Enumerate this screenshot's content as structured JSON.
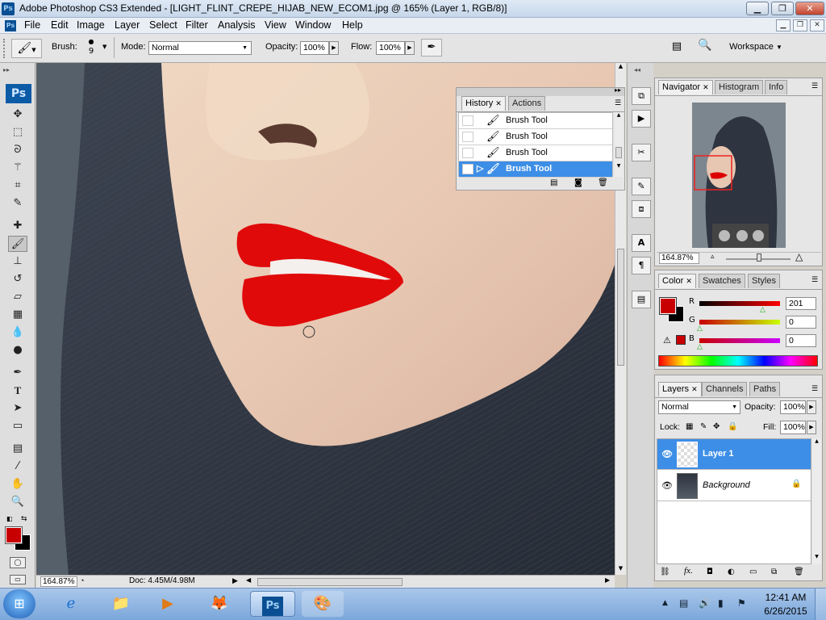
{
  "window": {
    "app_icon": "Ps",
    "title": "Adobe Photoshop CS3 Extended - [LIGHT_FLINT_CREPE_HIJAB_NEW_ECOM1.jpg @ 165% (Layer 1, RGB/8)]",
    "minimize": "▁",
    "restore": "❐",
    "close": "✕"
  },
  "menubar": {
    "icon": "Ps",
    "items": [
      "File",
      "Edit",
      "Image",
      "Layer",
      "Select",
      "Filter",
      "Analysis",
      "View",
      "Window",
      "Help"
    ]
  },
  "options": {
    "brush_label": "Brush:",
    "brush_size": "9",
    "mode_label": "Mode:",
    "mode_value": "Normal",
    "opacity_label": "Opacity:",
    "opacity_value": "100%",
    "flow_label": "Flow:",
    "flow_value": "100%",
    "workspace_label": "Workspace"
  },
  "tools": {
    "logo": "Ps",
    "items": [
      "move-tool-icon",
      "marquee-tool-icon",
      "lasso-tool-icon",
      "magic-wand-icon",
      "crop-tool-icon",
      "slice-tool-icon",
      "healing-brush-icon",
      "brush-tool-icon",
      "clone-stamp-icon",
      "history-brush-icon",
      "eraser-icon",
      "gradient-tool-icon",
      "blur-tool-icon",
      "dodge-tool-icon",
      "pen-tool-icon",
      "type-tool-icon",
      "path-selection-icon",
      "shape-tool-icon",
      "notes-tool-icon",
      "eyedropper-icon",
      "hand-tool-icon",
      "zoom-tool-icon"
    ],
    "foreground_color": "#c90000",
    "background_color": "#000000"
  },
  "status": {
    "zoom": "164.87%",
    "doc": "Doc: 4.45M/4.98M"
  },
  "history_panel": {
    "tabs": [
      "History",
      "Actions"
    ],
    "rows": [
      "Brush Tool",
      "Brush Tool",
      "Brush Tool",
      "Brush Tool"
    ],
    "selected_index": 3
  },
  "navigator_panel": {
    "tabs": [
      "Navigator",
      "Histogram",
      "Info"
    ],
    "zoom": "164.87%"
  },
  "color_panel": {
    "tabs": [
      "Color",
      "Swatches",
      "Styles"
    ],
    "r_label": "R",
    "g_label": "G",
    "b_label": "B",
    "r_value": "201",
    "g_value": "0",
    "b_value": "0",
    "fg_color": "#c90000"
  },
  "layers_panel": {
    "tabs": [
      "Layers",
      "Channels",
      "Paths"
    ],
    "blend_mode": "Normal",
    "opacity_label": "Opacity:",
    "opacity_value": "100%",
    "lock_label": "Lock:",
    "fill_label": "Fill:",
    "fill_value": "100%",
    "layers": [
      {
        "name": "Layer 1",
        "selected": true
      },
      {
        "name": "Background",
        "selected": false
      }
    ]
  },
  "taskbar": {
    "time": "12:41 AM",
    "date": "6/26/2015",
    "ps_label": "Ps"
  }
}
